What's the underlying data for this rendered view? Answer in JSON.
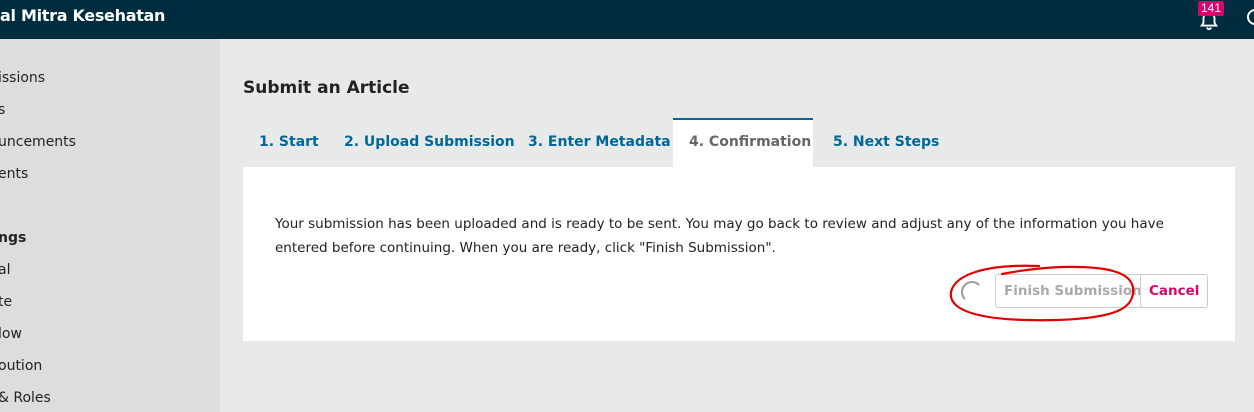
{
  "header": {
    "site_title": "al Mitra Kesehatan",
    "notification_count": "141"
  },
  "sidebar": {
    "items": [
      {
        "label": "issions",
        "heading": false
      },
      {
        "label": "s",
        "heading": false
      },
      {
        "label": "uncements",
        "heading": false
      },
      {
        "label": "ents",
        "heading": false
      },
      {
        "label": "ngs",
        "heading": true
      },
      {
        "label": "al",
        "heading": false
      },
      {
        "label": "te",
        "heading": false
      },
      {
        "label": "low",
        "heading": false
      },
      {
        "label": "oution",
        "heading": false
      },
      {
        "label": "& Roles",
        "heading": false
      }
    ]
  },
  "main": {
    "page_title": "Submit an Article",
    "tabs": [
      {
        "label": "1. Start",
        "active": false
      },
      {
        "label": "2. Upload Submission",
        "active": false
      },
      {
        "label": "3. Enter Metadata",
        "active": false
      },
      {
        "label": "4. Confirmation",
        "active": true
      },
      {
        "label": "5. Next Steps",
        "active": false
      }
    ],
    "message": "Your submission has been uploaded and is ready to be sent. You may go back to review and adjust any of the information you have entered before continuing. When you are ready, click \"Finish Submission\".",
    "finish_label": "Finish Submission",
    "cancel_label": "Cancel"
  },
  "colors": {
    "topbar": "#002c40",
    "link": "#006798",
    "accent": "#d00a6c",
    "annotation": "#e00000"
  },
  "icons": {
    "notifications": "bell-icon",
    "user": "user-icon",
    "loading": "spinner-icon"
  }
}
